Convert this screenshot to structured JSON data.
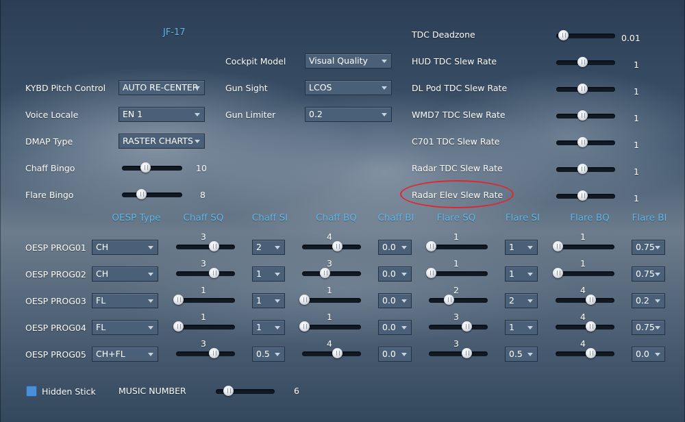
{
  "aircraft_title": "JF-17",
  "left_settings": [
    {
      "label": "KYBD Pitch Control",
      "value": "AUTO RE-CENTER"
    },
    {
      "label": "Voice Locale",
      "value": "EN 1"
    },
    {
      "label": "DMAP Type",
      "value": "RASTER CHARTS"
    }
  ],
  "chaff_bingo": {
    "label": "Chaff Bingo",
    "value": "10",
    "level": 0.4
  },
  "flare_bingo": {
    "label": "Flare Bingo",
    "value": "8",
    "level": 0.33
  },
  "mid_settings": [
    {
      "label": "Cockpit Model",
      "value": "Visual Quality"
    },
    {
      "label": "Gun Sight",
      "value": "LCOS"
    },
    {
      "label": "Gun Limiter",
      "value": "0.2"
    }
  ],
  "right_settings": [
    {
      "label": "TDC Deadzone",
      "value": "0.01",
      "level": 0.13
    },
    {
      "label": "HUD TDC Slew Rate",
      "value": "1",
      "level": 0.45
    },
    {
      "label": "DL Pod TDC Slew Rate",
      "value": "1",
      "level": 0.45
    },
    {
      "label": "WMD7 TDC Slew Rate",
      "value": "1",
      "level": 0.45
    },
    {
      "label": "C701 TDC Slew Rate",
      "value": "1",
      "level": 0.45
    },
    {
      "label": "Radar TDC Slew Rate",
      "value": "1",
      "level": 0.45
    },
    {
      "label": "Radar Elev Slew Rate",
      "value": "1",
      "level": 0.45
    }
  ],
  "oesp": {
    "headers": [
      "OESP Type",
      "Chaff SQ",
      "Chaff SI",
      "Chaff BQ",
      "Chaff BI",
      "Flare SQ",
      "Flare SI",
      "Flare BQ",
      "Flare BI"
    ],
    "programs": [
      {
        "label": "OESP PROG01",
        "type": "CH",
        "chaff_sq": "3",
        "chaff_sq_level": 0.65,
        "chaff_si": "2",
        "chaff_bq": "4",
        "chaff_bq_level": 0.6,
        "chaff_bi": "0.0",
        "flare_sq": "1",
        "flare_sq_level": 0.05,
        "flare_si": "1",
        "flare_bq": "1",
        "flare_bq_level": 0.05,
        "flare_bi": "0.75"
      },
      {
        "label": "OESP PROG02",
        "type": "CH",
        "chaff_sq": "3",
        "chaff_sq_level": 0.65,
        "chaff_si": "1",
        "chaff_bq": "3",
        "chaff_bq_level": 0.4,
        "chaff_bi": "0.0",
        "flare_sq": "1",
        "flare_sq_level": 0.05,
        "flare_si": "1",
        "flare_bq": "1",
        "flare_bq_level": 0.05,
        "flare_bi": "0.75"
      },
      {
        "label": "OESP PROG03",
        "type": "FL",
        "chaff_sq": "1",
        "chaff_sq_level": 0.05,
        "chaff_si": "1",
        "chaff_bq": "1",
        "chaff_bq_level": 0.05,
        "chaff_bi": "0.0",
        "flare_sq": "2",
        "flare_sq_level": 0.35,
        "flare_si": "2",
        "flare_bq": "4",
        "flare_bq_level": 0.6,
        "flare_bi": "0.2"
      },
      {
        "label": "OESP PROG04",
        "type": "FL",
        "chaff_sq": "1",
        "chaff_sq_level": 0.05,
        "chaff_si": "1",
        "chaff_bq": "1",
        "chaff_bq_level": 0.05,
        "chaff_bi": "0.0",
        "flare_sq": "3",
        "flare_sq_level": 0.65,
        "flare_si": "1",
        "flare_bq": "4",
        "flare_bq_level": 0.6,
        "flare_bi": "0.75"
      },
      {
        "label": "OESP PROG05",
        "type": "CH+FL",
        "chaff_sq": "3",
        "chaff_sq_level": 0.65,
        "chaff_si": "0.5",
        "chaff_bq": "4",
        "chaff_bq_level": 0.6,
        "chaff_bi": "0.0",
        "flare_sq": "3",
        "flare_sq_level": 0.65,
        "flare_si": "0.5",
        "flare_bq": "4",
        "flare_bq_level": 0.6,
        "flare_bi": "0.0"
      }
    ]
  },
  "hidden_stick": {
    "label": "Hidden Stick",
    "checked": true
  },
  "music": {
    "label": "MUSIC NUMBER",
    "value": "6",
    "level": 0.22
  },
  "icons": {
    "dropdown": "chevron-down-icon",
    "slider": "slider-knob"
  },
  "colors": {
    "accent": "#5fb8e8",
    "highlight": "#e0262e",
    "checkbox": "#4b8fd6"
  }
}
